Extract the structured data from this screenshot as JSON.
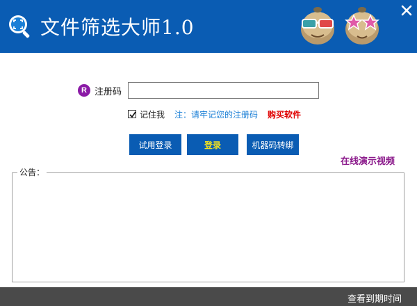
{
  "app": {
    "title": "文件筛选大师1.0",
    "brand_color": "#0a5cb3",
    "logo_icon": "magnifier-scan-icon",
    "mascots": [
      "3d-glasses-mascot",
      "star-glasses-mascot"
    ],
    "close_icon": "close-icon"
  },
  "register": {
    "badge": "R",
    "label": "注册码",
    "value": "",
    "remember_checked": true,
    "remember_label": "记住我",
    "note": "注：请牢记您的注册码",
    "buy_label": "购买软件"
  },
  "buttons": {
    "trial": "试用登录",
    "login": "登录",
    "transfer": "机器码转绑"
  },
  "demo_link": "在线演示视频",
  "notice": {
    "label": "公告：",
    "content": ""
  },
  "status": {
    "expiry_label": "查看到期时间"
  }
}
